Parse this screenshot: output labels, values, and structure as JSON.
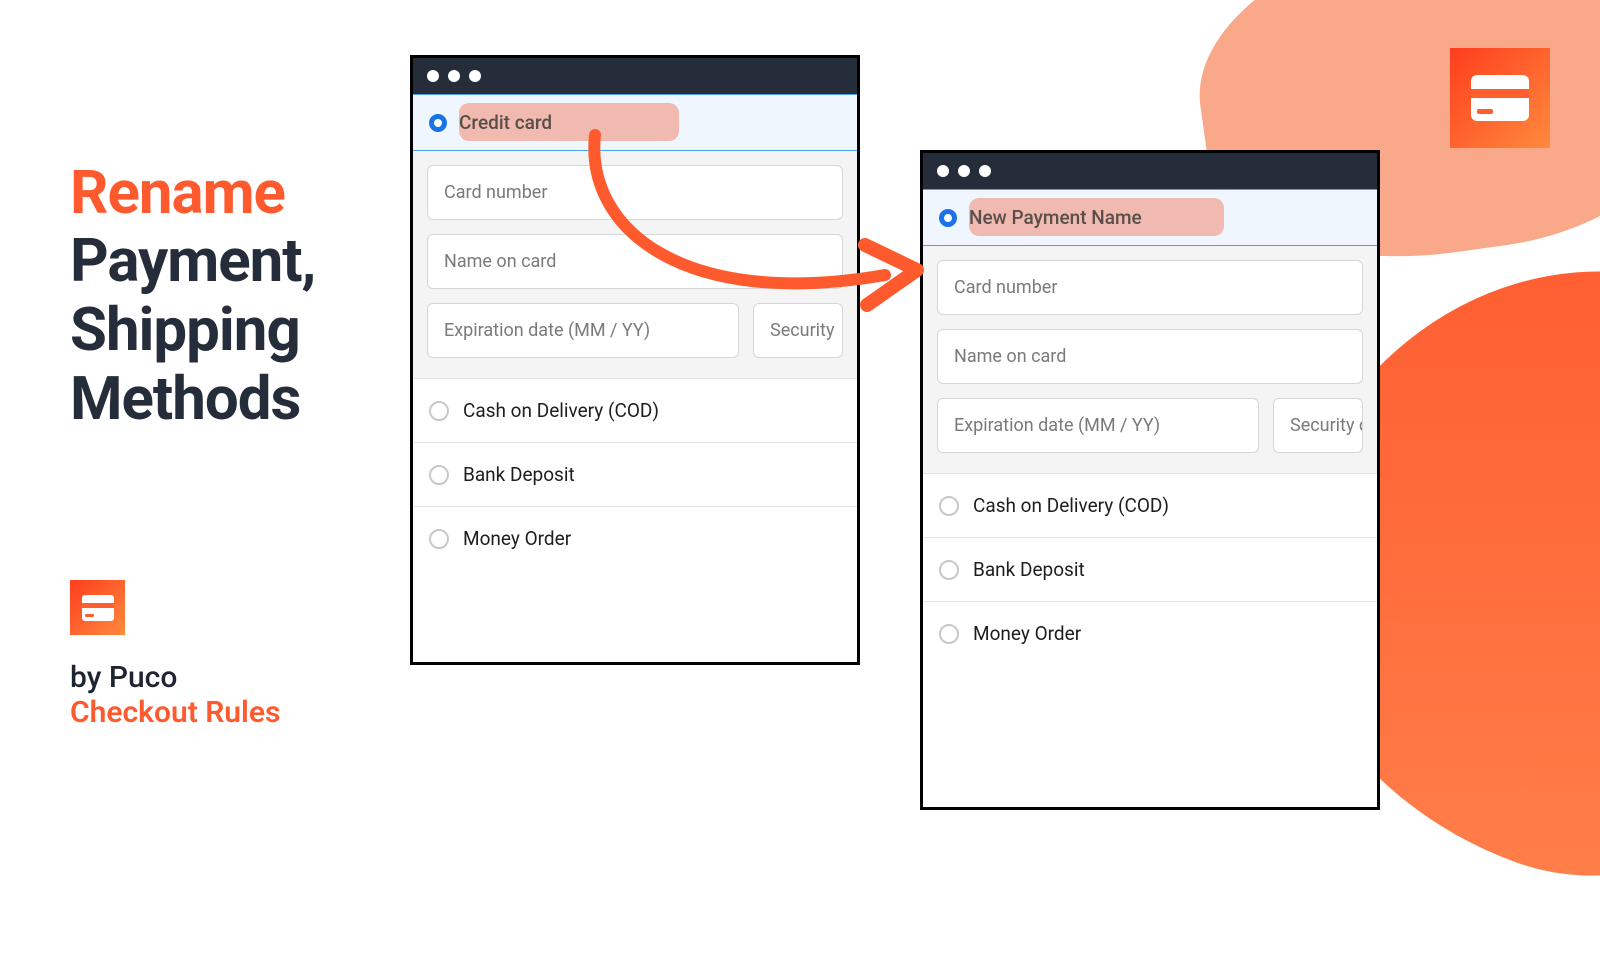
{
  "heading": {
    "line1": "Rename",
    "line2": "Payment,",
    "line3": "Shipping",
    "line4": "Methods"
  },
  "byline": {
    "line1": "by Puco",
    "line2": "Checkout Rules"
  },
  "icons": {
    "topright": "credit-card-icon",
    "logo": "credit-card-icon"
  },
  "window_left": {
    "selected_method": "Credit card",
    "fields": {
      "card_number": "Card number",
      "name_on_card": "Name on card",
      "expiration": "Expiration date (MM / YY)",
      "security": "Security"
    },
    "other_methods": [
      "Cash on Delivery (COD)",
      "Bank Deposit",
      "Money Order"
    ]
  },
  "window_right": {
    "selected_method": "New Payment Name",
    "fields": {
      "card_number": "Card number",
      "name_on_card": "Name on card",
      "expiration": "Expiration date (MM / YY)",
      "security": "Security c"
    },
    "other_methods": [
      "Cash on Delivery (COD)",
      "Bank Deposit",
      "Money Order"
    ]
  },
  "colors": {
    "accent_orange": "#ff5a2e",
    "dark": "#252c3a",
    "highlight": "#f1a696",
    "radio_blue": "#1a73e8"
  }
}
